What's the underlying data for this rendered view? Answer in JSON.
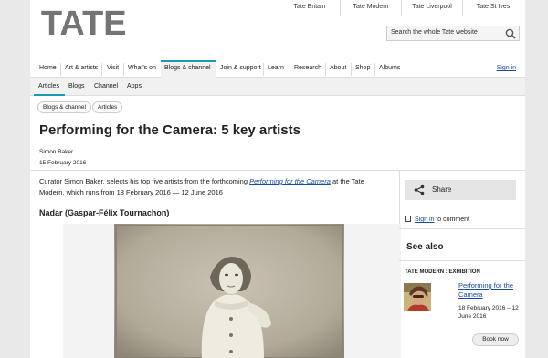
{
  "brand": {
    "logo": "TATE",
    "accent": "#1b9ab8",
    "link": "#1a4ba0"
  },
  "top_links": [
    "Tate Britain",
    "Tate Modern",
    "Tate Liverpool",
    "Tate St Ives"
  ],
  "search": {
    "placeholder": "Search the whole Tate website",
    "icon": "search-icon"
  },
  "main_nav": {
    "items": [
      "Home",
      "Art & artists",
      "Visit",
      "What's on",
      "Blogs & channel",
      "Join & support",
      "Learn",
      "Research",
      "About",
      "Shop",
      "Albums"
    ],
    "active": "Blogs & channel",
    "signin": "Sign in"
  },
  "sub_nav": {
    "items": [
      "Articles",
      "Blogs",
      "Channel",
      "Apps"
    ],
    "active": "Articles"
  },
  "breadcrumb": [
    "Blogs & channel",
    "Articles"
  ],
  "article": {
    "title": "Performing for the Camera: 5 key artists",
    "author": "Simon Baker",
    "date": "15 February 2016",
    "intro_before": "Curator Simon Baker, selects his top five artists from the forthcoming ",
    "intro_link": "Performing for the Camera",
    "intro_after": " at the Tate Modern, which runs from 18 February 2016 — 12 June 2016",
    "heading": "Nadar (Gaspar-Félix Tournachon)"
  },
  "sidebar": {
    "share_label": "Share",
    "signin_link": "Sign in",
    "comment_text": " to comment",
    "see_also": "See also",
    "exhibition_label": "TATE MODERN : EXHIBITION",
    "exhibition_title": "Performing for the Camera",
    "exhibition_dates": "18 February 2016 – 12 June 2016",
    "book_now": "Book now"
  }
}
